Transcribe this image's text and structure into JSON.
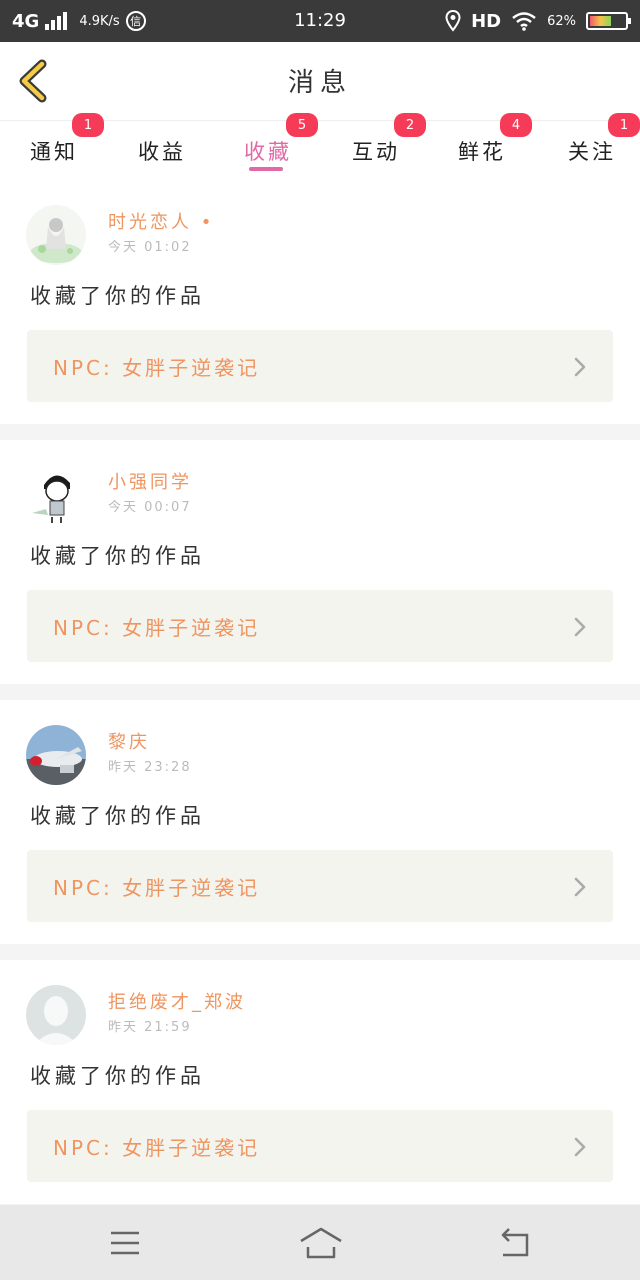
{
  "status_bar": {
    "network": "4G",
    "speed": "4.9K/s",
    "data_icon": "信",
    "time": "11:29",
    "hd": "HD",
    "battery_percent": "62%",
    "battery_level": 0.62
  },
  "header": {
    "title": "消息",
    "back_icon": "chevron-left-icon"
  },
  "tabs": [
    {
      "label": "通知",
      "badge": "1",
      "active": false
    },
    {
      "label": "收益",
      "badge": "",
      "active": false
    },
    {
      "label": "收藏",
      "badge": "5",
      "active": true
    },
    {
      "label": "互动",
      "badge": "2",
      "active": false
    },
    {
      "label": "鲜花",
      "badge": "4",
      "active": false
    },
    {
      "label": "关注",
      "badge": "1",
      "active": false
    }
  ],
  "messages": [
    {
      "user": "时光恋人 •",
      "time": "今天 01:02",
      "action": "收藏了你的作品",
      "work": "NPC: 女胖子逆袭记"
    },
    {
      "user": "小强同学",
      "time": "今天 00:07",
      "action": "收藏了你的作品",
      "work": "NPC: 女胖子逆袭记"
    },
    {
      "user": "黎庆",
      "time": "昨天 23:28",
      "action": "收藏了你的作品",
      "work": "NPC: 女胖子逆袭记"
    },
    {
      "user": "拒绝废才_郑波",
      "time": "昨天 21:59",
      "action": "收藏了你的作品",
      "work": "NPC: 女胖子逆袭记"
    }
  ],
  "colors": {
    "accent": "#e06aa7",
    "name": "#ef9560",
    "badge": "#f53b57"
  },
  "navbar": {
    "menu_icon": "menu-icon",
    "home_icon": "home-icon",
    "back_icon": "back-arrow-icon"
  }
}
